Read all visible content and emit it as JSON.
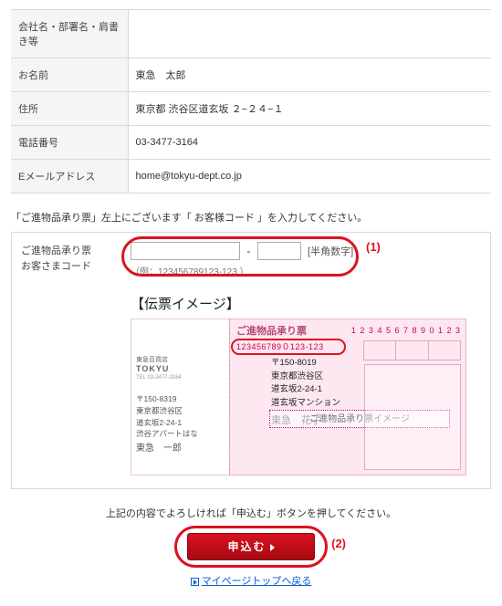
{
  "info": {
    "rows": [
      {
        "label": "会社名・部署名・肩書き等",
        "value": ""
      },
      {
        "label": "お名前",
        "value": "東急　太郎"
      },
      {
        "label": "住所",
        "value": "東京都 渋谷区道玄坂 ２−２４−１"
      },
      {
        "label": "電話番号",
        "value": "03-3477-3164"
      },
      {
        "label": "Eメールアドレス",
        "value": "home@tokyu-dept.co.jp"
      }
    ]
  },
  "instruction": "「ご進物品承り票」左上にございます「 お客様コード 」を入力してください。",
  "code": {
    "label1": "ご進物品承り票",
    "label2": "お客さまコード",
    "hint": "[半角数字]",
    "example": "（例：123456789123-123 ）",
    "annotation": "(1)"
  },
  "slip": {
    "heading": "【伝票イメージ】",
    "title": "ご進物品承り票",
    "digits": "1 2 3 4 5 6 7 8 9 0 1 2 3",
    "code_sample": "123456789０123-123",
    "dest_zip": "〒150-8019",
    "dest_l1": "東京都渋谷区",
    "dest_l2": "道玄坂2-24-1",
    "dest_l3": "道玄坂マンション",
    "dest_name": "東急　花子",
    "overlay": "ご進物品承り票イメージ",
    "brand_small": "東急百貨店",
    "brand": "TOKYU",
    "brand_tel": "TEL 03-3477-3164",
    "sender_zip": "〒150-8319",
    "sender_l1": "東京都渋谷区",
    "sender_l2": "道玄坂2-24-1",
    "sender_l3": "渋谷アパートはな",
    "sender_name": "東急　一郎"
  },
  "confirm_text": "上記の内容でよろしければ「申込む」ボタンを押してください。",
  "button": {
    "label": "申込む",
    "annotation": "(2)"
  },
  "back_link": "マイページトップへ戻る"
}
